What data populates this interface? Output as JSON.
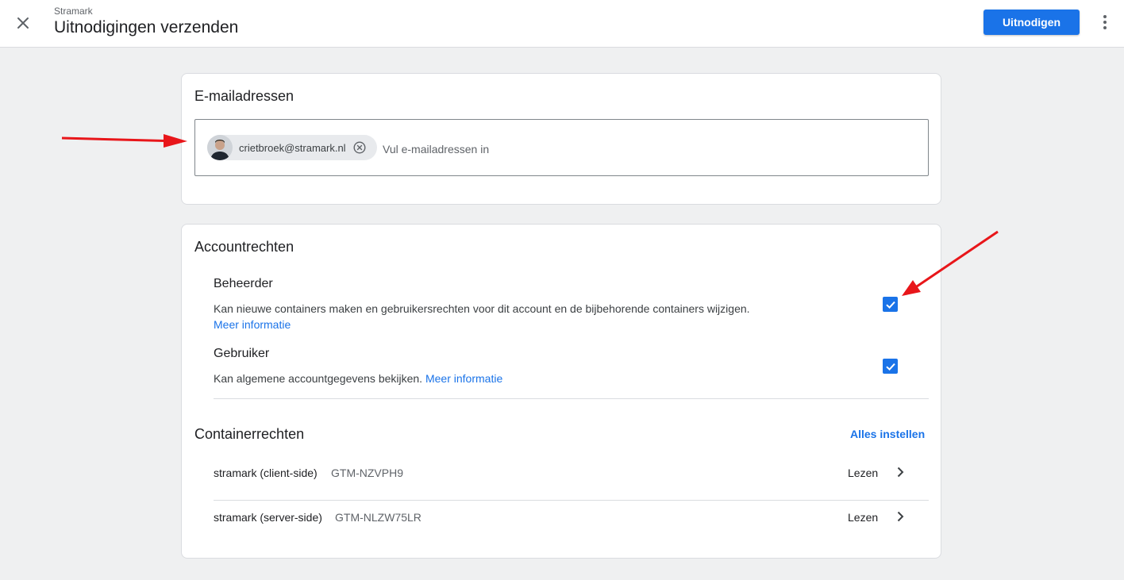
{
  "header": {
    "breadcrumb": "Stramark",
    "title": "Uitnodigingen verzenden",
    "invite_label": "Uitnodigen"
  },
  "email_section": {
    "title": "E-mailadressen",
    "chips": [
      {
        "email": "crietbroek@stramark.nl"
      }
    ],
    "placeholder": "Vul e-mailadressen in"
  },
  "account_rights": {
    "title": "Accountrechten",
    "roles": [
      {
        "name": "Beheerder",
        "description": "Kan nieuwe containers maken en gebruikersrechten voor dit account en de bijbehorende containers wijzigen.",
        "link": "Meer informatie",
        "checked": true
      },
      {
        "name": "Gebruiker",
        "description": "Kan algemene accountgegevens bekijken.",
        "link": "Meer informatie",
        "checked": true
      }
    ]
  },
  "container_rights": {
    "title": "Containerrechten",
    "set_all_label": "Alles instellen",
    "containers": [
      {
        "name": "stramark (client-side)",
        "id": "GTM-NZVPH9",
        "permission": "Lezen"
      },
      {
        "name": "stramark (server-side)",
        "id": "GTM-NLZW75LR",
        "permission": "Lezen"
      }
    ]
  },
  "colors": {
    "accent": "#1a73e8",
    "background": "#eff0f1",
    "annotation_arrow": "#e8161a"
  },
  "icons": {
    "close": "close-icon",
    "more": "more-vert-icon",
    "chip_remove": "cancel-circle-icon",
    "checkbox": "check-icon",
    "row": "chevron-right-icon"
  }
}
